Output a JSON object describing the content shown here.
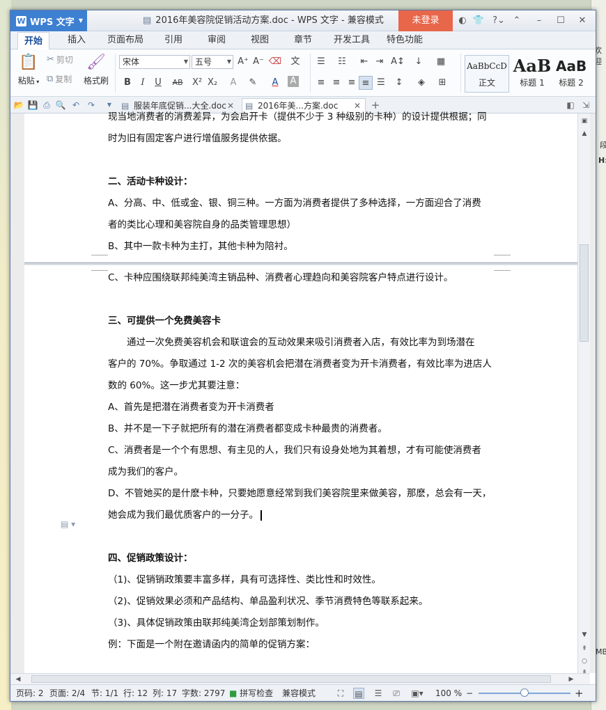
{
  "window": {
    "app_name": "WPS 文字",
    "app_logo_letter": "W",
    "document_title": "2016年美容院促销活动方案.doc - WPS 文字 - 兼容模式",
    "login_label": "未登录"
  },
  "menu_tabs": [
    "开始",
    "插入",
    "页面布局",
    "引用",
    "审阅",
    "视图",
    "章节",
    "开发工具",
    "特色功能"
  ],
  "ribbon": {
    "paste_label": "粘贴",
    "cut_label": "剪切",
    "copy_label": "复制",
    "format_painter_label": "格式刷",
    "font_name": "宋体",
    "font_size": "五号",
    "styles": [
      {
        "preview": "AaBbCcD",
        "label": "正文"
      },
      {
        "preview": "AaB",
        "label": "标题 1"
      },
      {
        "preview": "AaB",
        "label": "标题 2"
      }
    ]
  },
  "doc_tabs": [
    {
      "label": "服装年底促销...大全.doc",
      "active": false
    },
    {
      "label": "2016年美...方案.doc",
      "active": true
    }
  ],
  "document": {
    "page1_lines": [
      {
        "text": "现当地消费者的消费差异，为会启开卡（提供不少于 3 种级别的卡种）的设计提供根据；同",
        "bold": false
      },
      {
        "text": "时为旧有固定客户进行增值服务提供依据。",
        "bold": false
      },
      {
        "text": "",
        "bold": false
      },
      {
        "text": "二、活动卡种设计：",
        "bold": true
      },
      {
        "text": "A、分高、中、低或金、银、铜三种。一方面为消费者提供了多种选择，一方面迎合了消费",
        "bold": false
      },
      {
        "text": "者的类比心理和美容院自身的品类管理思想）",
        "bold": false
      },
      {
        "text": "B、其中一款卡种为主打，其他卡种为陪衬。",
        "bold": false
      }
    ],
    "page2_lines": [
      {
        "text": "C、卡种应围绕联邦纯美湾主销品种、消费者心理趋向和美容院客户特点进行设计。",
        "bold": false
      },
      {
        "text": "",
        "bold": false
      },
      {
        "text": "三、可提供一个免费美容卡",
        "bold": true
      },
      {
        "text": "　　通过一次免费美容机会和联谊会的互动效果来吸引消费者入店，有效比率为到场潜在",
        "bold": false
      },
      {
        "text": "客户的 70%。争取通过 1-2 次的美容机会把潜在消费者变为开卡消费者，有效比率为进店人",
        "bold": false
      },
      {
        "text": "数的 60%。这一步尤其要注意：",
        "bold": false
      },
      {
        "text": "A、首先是把潜在消费者变为开卡消费者",
        "bold": false
      },
      {
        "text": "B、并不是一下子就把所有的潜在消费者都变成卡种最贵的消费者。",
        "bold": false
      },
      {
        "text": "C、消费者是一个个有思想、有主见的人，我们只有设身处地为其着想，才有可能使消费者",
        "bold": false
      },
      {
        "text": "成为我们的客户。",
        "bold": false
      },
      {
        "text": "D、不管她买的是什麽卡种，只要她愿意经常到我们美容院里来做美容，那麽，总会有一天，",
        "bold": false
      },
      {
        "text": "她会成为我们最优质客户的一分子。",
        "bold": false
      },
      {
        "text": "",
        "bold": false
      },
      {
        "text": "四、促销政策设计：",
        "bold": true
      },
      {
        "text": "（1)、促销销政策要丰富多样，具有可选择性、类比性和时效性。",
        "bold": false
      },
      {
        "text": "（2)、促销效果必须和产品结构、单品盈利状况、季节消费特色等联系起来。",
        "bold": false
      },
      {
        "text": "（3)、具体促销政策由联邦纯美湾企划部策划制作。",
        "bold": false
      },
      {
        "text": "例：下面是一个附在邀请函内的简单的促销方案：",
        "bold": false
      }
    ]
  },
  "status": {
    "page_num": "页码: 2",
    "pages": "页面: 2/4",
    "section": "节: 1/1",
    "row": "行: 12",
    "col": "列: 17",
    "word_count": "字数: 2797",
    "spell_check": "拼写检查",
    "compat_mode": "兼容模式",
    "zoom": "100 %",
    "zoom_fraction": 0.5
  },
  "background": {
    "right_text_1": "欢迎",
    "right_text_2": "段",
    "right_text_3": "H:",
    "right_text_4": "MB"
  },
  "colors": {
    "accent": "#3d7fd1",
    "login": "#e8664a"
  }
}
